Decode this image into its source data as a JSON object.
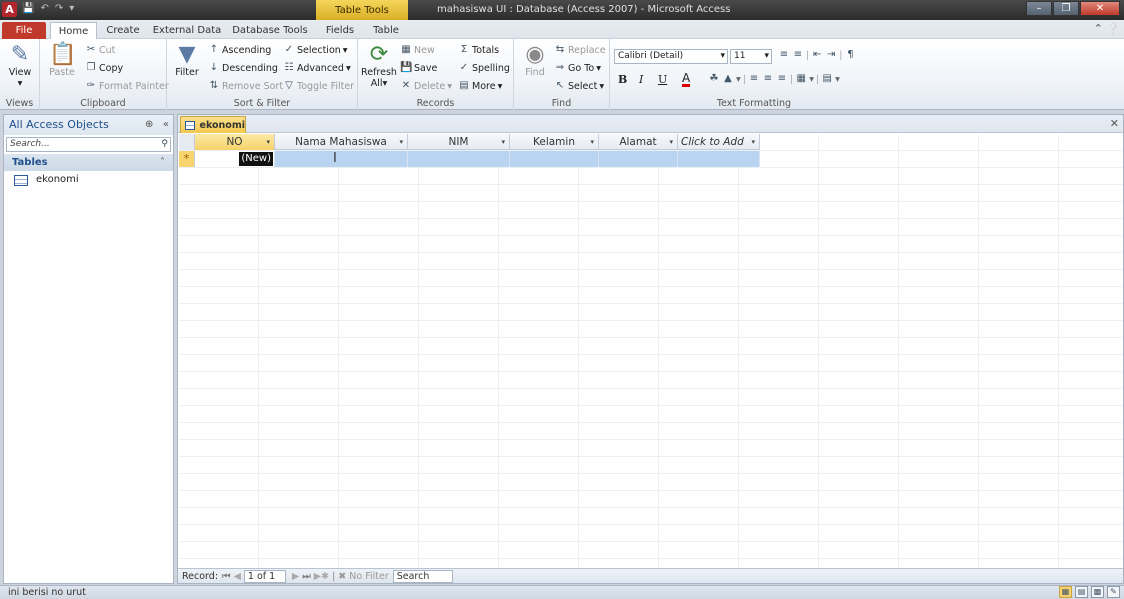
{
  "window": {
    "title": "mahasiswa UI : Database (Access 2007)  -  Microsoft Access",
    "context_tab": "Table Tools",
    "app_icon": "A"
  },
  "tabs": [
    "File",
    "Home",
    "Create",
    "External Data",
    "Database Tools",
    "Fields",
    "Table"
  ],
  "ribbon": {
    "views": {
      "label": "Views",
      "view": "View"
    },
    "clipboard": {
      "label": "Clipboard",
      "paste": "Paste",
      "cut": "Cut",
      "copy": "Copy",
      "format_painter": "Format Painter"
    },
    "sort_filter": {
      "label": "Sort & Filter",
      "filter": "Filter",
      "ascending": "Ascending",
      "descending": "Descending",
      "remove_sort": "Remove Sort",
      "selection": "Selection",
      "advanced": "Advanced",
      "toggle_filter": "Toggle Filter"
    },
    "records": {
      "label": "Records",
      "refresh": "Refresh",
      "refresh_sub": "All",
      "new": "New",
      "save": "Save",
      "delete": "Delete",
      "totals": "Totals",
      "spelling": "Spelling",
      "more": "More"
    },
    "find": {
      "label": "Find",
      "find": "Find",
      "replace": "Replace",
      "goto": "Go To",
      "select": "Select"
    },
    "text_formatting": {
      "label": "Text Formatting",
      "font": "Calibri (Detail)",
      "size": "11",
      "bold": "B",
      "italic": "I",
      "underline": "U",
      "font_color": "A"
    }
  },
  "nav": {
    "header": "All Access Objects",
    "search_placeholder": "Search...",
    "section": "Tables",
    "items": [
      "ekonomi"
    ]
  },
  "document": {
    "tab": "ekonomi",
    "columns": [
      {
        "label": "NO",
        "width": 80
      },
      {
        "label": "Nama Mahasiswa",
        "width": 133
      },
      {
        "label": "NIM",
        "width": 102
      },
      {
        "label": "Kelamin",
        "width": 89
      },
      {
        "label": "Alamat",
        "width": 79
      },
      {
        "label": "Click to Add",
        "width": 82
      }
    ],
    "new_row_marker": "*",
    "new_tag": "(New)"
  },
  "record_nav": {
    "label": "Record:",
    "position": "1 of 1",
    "filter": "No Filter",
    "search": "Search"
  },
  "status": {
    "text": "ini berisi no urut"
  }
}
